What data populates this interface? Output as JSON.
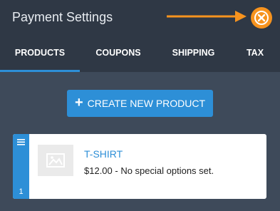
{
  "header": {
    "title": "Payment Settings",
    "close_icon": "close-x-circle-icon",
    "annotation_arrow_color": "#f7931e"
  },
  "tabs": [
    {
      "label": "PRODUCTS",
      "active": true
    },
    {
      "label": "COUPONS",
      "active": false
    },
    {
      "label": "SHIPPING",
      "active": false
    },
    {
      "label": "TAX",
      "active": false
    }
  ],
  "actions": {
    "create_label": "CREATE NEW PRODUCT",
    "create_icon": "plus-icon"
  },
  "products": [
    {
      "index": "1",
      "name": "T-SHIRT",
      "description": "$12.00 - No special options set.",
      "image_icon": "image-placeholder-icon"
    }
  ],
  "colors": {
    "accent": "#2d8fd7",
    "header_bg": "#2f3845",
    "body_bg": "#3e4a5a",
    "close_button": "#f7931e"
  }
}
